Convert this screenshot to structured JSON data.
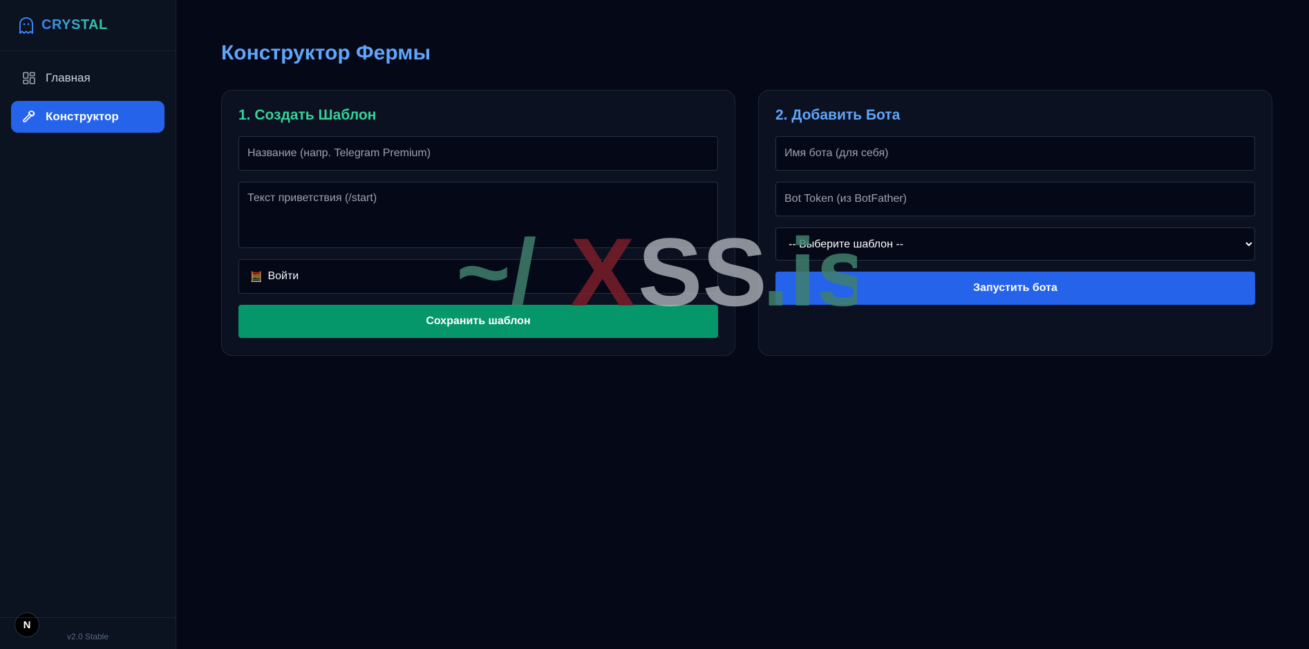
{
  "sidebar": {
    "brand": "CRYSTAL",
    "items": [
      {
        "label": "Главная",
        "icon": "dashboard-icon",
        "active": false
      },
      {
        "label": "Конструктор",
        "icon": "hammer-icon",
        "active": true
      }
    ],
    "version": "v2.0 Stable",
    "badge": "N"
  },
  "main": {
    "title": "Конструктор Фермы",
    "template_card": {
      "heading": "1. Создать Шаблон",
      "name_placeholder": "Название (напр. Telegram Premium)",
      "greeting_placeholder": "Текст приветствия (/start)",
      "button_label": "Войти",
      "button_icon": "🧮",
      "save_label": "Сохранить шаблон"
    },
    "bot_card": {
      "heading": "2. Добавить Бота",
      "bot_name_placeholder": "Имя бота (для себя)",
      "token_placeholder": "Bot Token (из BotFather)",
      "template_select_value": "-- Выберите шаблон --",
      "launch_label": "Запустить бота"
    }
  },
  "watermark": {
    "prefix": "~/",
    "x": "X",
    "ss": "SS",
    "suffix": ".is"
  },
  "colors": {
    "accent_blue": "#2563eb",
    "accent_green": "#059669",
    "title_blue": "#60a5fa",
    "heading_green": "#34d399",
    "background": "#050816"
  }
}
